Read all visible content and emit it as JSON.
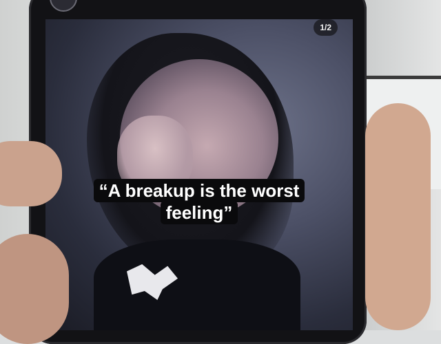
{
  "post": {
    "page_indicator": "1/2",
    "caption_line_1": "“A breakup is the worst",
    "caption_line_2": "feeling”"
  }
}
